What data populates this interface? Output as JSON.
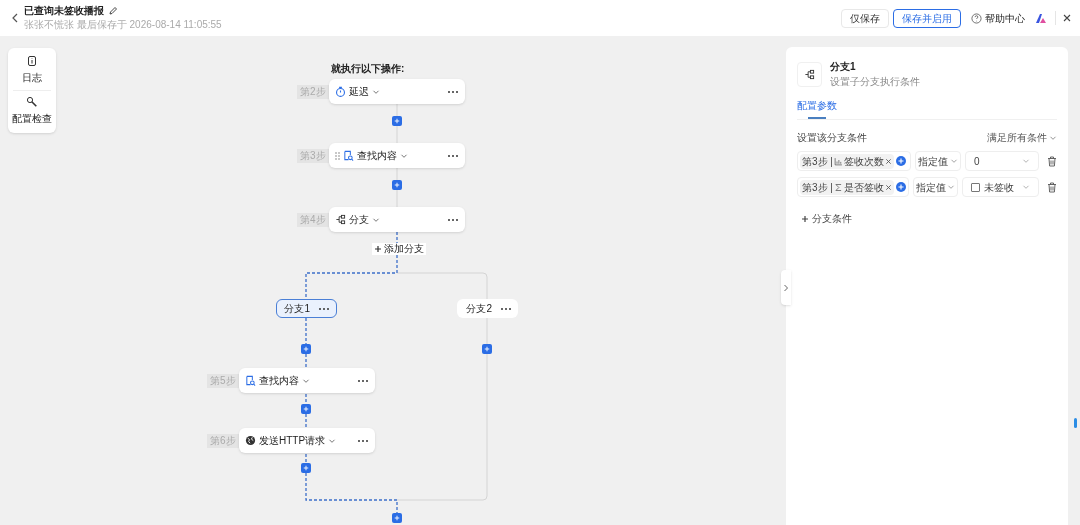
{
  "header": {
    "title": "已查询未签收播报",
    "subtitle": "张张不慌张 最后保存于 2026-08-14 11:05:55",
    "buttons": [
      {
        "label": "仅保存",
        "kind": "default"
      },
      {
        "label": "保存并启用",
        "kind": "primary"
      }
    ],
    "help": "帮助中心"
  },
  "toolbar": [
    {
      "label": "日志"
    },
    {
      "label": "配置检查"
    }
  ],
  "canvas": {
    "heading": "就执行以下操作:",
    "add_branch": "添加分支",
    "steps": [
      {
        "step": "第2步",
        "label": "延迟",
        "kind": "delay",
        "drag_handle": false
      },
      {
        "step": "第3步",
        "label": "查找内容",
        "kind": "find",
        "drag_handle": true
      },
      {
        "step": "第4步",
        "label": "分支",
        "kind": "branch",
        "drag_handle": false
      }
    ],
    "branches": [
      {
        "label": "分支1",
        "selected": true
      },
      {
        "label": "分支2",
        "selected": false
      }
    ],
    "branch_steps": [
      {
        "step": "第5步",
        "label": "查找内容",
        "kind": "find",
        "drag_handle": false
      },
      {
        "step": "第6步",
        "label": "发送HTTP请求",
        "kind": "http",
        "drag_handle": false
      }
    ]
  },
  "panel": {
    "title": "分支1",
    "subtitle": "设置子分支执行条件",
    "tabs": [
      {
        "label": "配置参数",
        "selected": true
      }
    ],
    "section": "设置该分支条件",
    "match_mode": "满足所有条件",
    "conditions": [
      {
        "kind": "number",
        "source": "第3步 |",
        "field": "签收次数",
        "operator": "指定值",
        "value": "0"
      },
      {
        "kind": "boolean",
        "source": "第3步 |",
        "field": "是否签收",
        "operator": "指定值",
        "value": "未签收",
        "checked": false
      }
    ],
    "add_condition": "分支条件"
  }
}
